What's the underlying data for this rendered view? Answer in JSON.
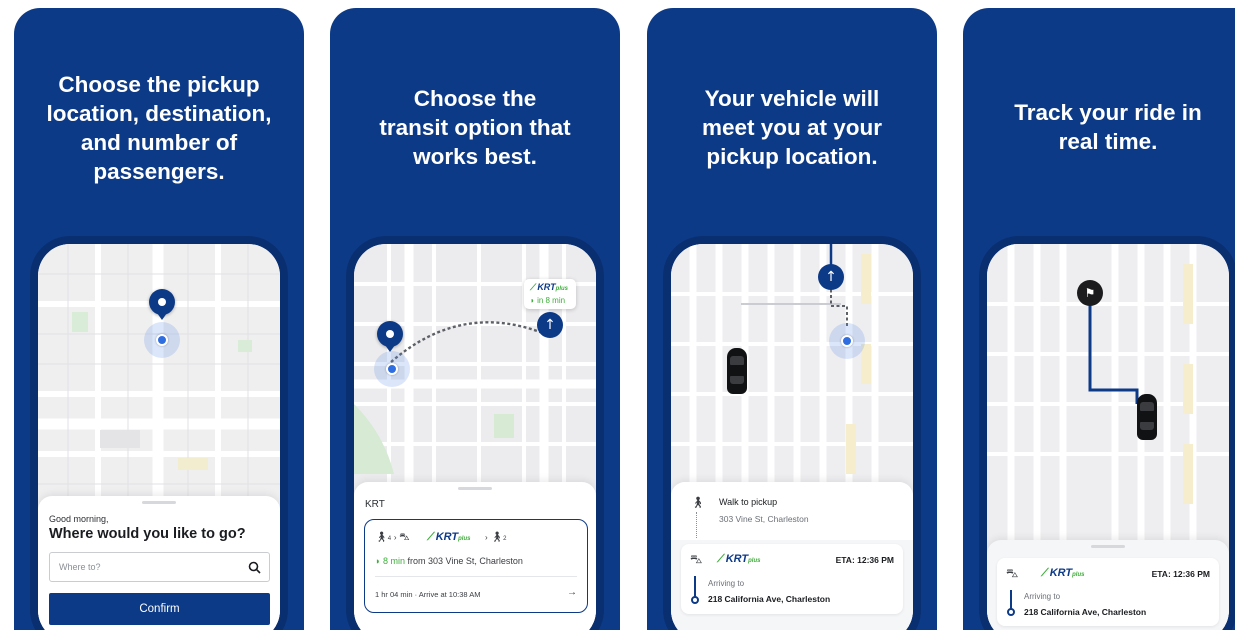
{
  "panels": [
    {
      "headline": [
        "Choose the pickup",
        "location, destination,",
        "and number of",
        "passengers."
      ],
      "greeting": "Good morning,",
      "question": "Where would you like to go?",
      "search_placeholder": "Where to?",
      "confirm_label": "Confirm"
    },
    {
      "headline": [
        "Choose the",
        "transit option that",
        "works best."
      ],
      "badge_brand": "KRT",
      "badge_brand_suffix": "plus",
      "badge_time": "in 8 min",
      "sheet_title": "KRT",
      "route_walk1": "4",
      "route_walk2": "2",
      "route_brand": "KRT",
      "route_brand_suffix": "plus",
      "route_eta_highlight": "8 min",
      "route_eta_rest": "from 303 Vine St, Charleston",
      "route_duration": "1 hr 04 min",
      "route_arrive": "Arrive at 10:38 AM"
    },
    {
      "headline": [
        "Your vehicle will",
        "meet you at your",
        "pickup location."
      ],
      "walk_title": "Walk to pickup",
      "walk_address": "303 Vine St, Charleston",
      "brand": "KRT",
      "brand_suffix": "plus",
      "eta": "ETA: 12:36 PM",
      "arriving_label": "Arriving to",
      "arriving_address": "218 California Ave, Charleston"
    },
    {
      "headline": [
        "Track your ride in",
        "real time."
      ],
      "brand": "KRT",
      "brand_suffix": "plus",
      "eta": "ETA: 12:36 PM",
      "arriving_label": "Arriving to",
      "arriving_address": "218 California Ave, Charleston"
    }
  ],
  "icons": {
    "search": "search-icon",
    "walk": "walk-icon",
    "bus": "bus-icon",
    "chevron": "chevron-right-icon",
    "arrow": "arrow-right-icon",
    "flag": "flag-icon",
    "pin": "location-pin-icon",
    "car": "car-icon"
  },
  "colors": {
    "brand_blue": "#0d3a87",
    "accent_green": "#3fae3c",
    "location_blue": "#2f6ee0"
  }
}
